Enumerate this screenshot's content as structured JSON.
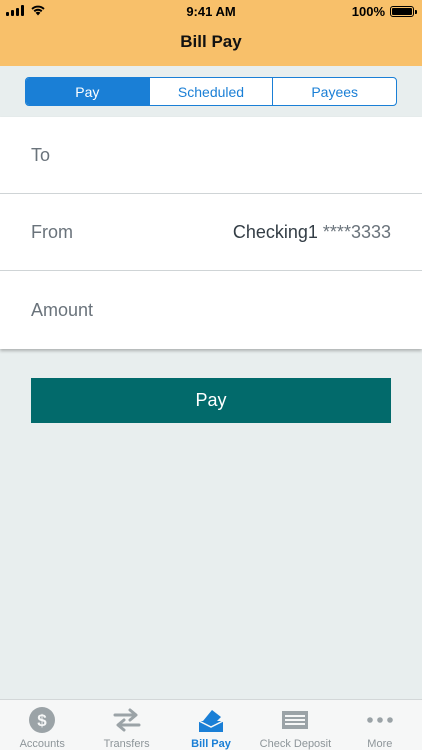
{
  "status_bar": {
    "time": "9:41 AM",
    "battery": "100%"
  },
  "header": {
    "title": "Bill Pay"
  },
  "segments": [
    {
      "label": "Pay",
      "active": true
    },
    {
      "label": "Scheduled",
      "active": false
    },
    {
      "label": "Payees",
      "active": false
    }
  ],
  "form": {
    "to_label": "To",
    "from_label": "From",
    "from_account_name": "Checking1",
    "from_account_number": " ****3333",
    "amount_label": "Amount"
  },
  "pay_button": {
    "label": "Pay"
  },
  "tabbar": {
    "items": [
      {
        "label": "Accounts",
        "icon": "dollar-coin-icon"
      },
      {
        "label": "Transfers",
        "icon": "transfer-arrows-icon"
      },
      {
        "label": "Bill Pay",
        "icon": "bill-pay-envelope-icon",
        "active": true
      },
      {
        "label": "Check Deposit",
        "icon": "check-icon"
      },
      {
        "label": "More",
        "icon": "more-dots-icon"
      }
    ]
  },
  "colors": {
    "header_bg": "#f8c06a",
    "accent_blue": "#1a7fd6",
    "pay_button_bg": "#026a6b",
    "page_bg": "#e8eeee"
  }
}
